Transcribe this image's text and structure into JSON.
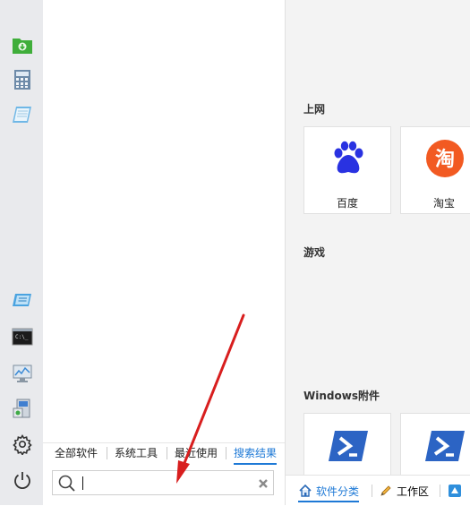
{
  "tabs": [
    {
      "label": "全部软件"
    },
    {
      "label": "系统工具"
    },
    {
      "label": "最近使用"
    },
    {
      "label": "搜索结果",
      "active": true
    }
  ],
  "search": {
    "value": "",
    "placeholder": ""
  },
  "sections": {
    "internet": {
      "title": "上网",
      "apps": [
        {
          "label": "百度",
          "icon": "baidu-paw-icon"
        },
        {
          "label": "淘宝",
          "icon": "taobao-icon"
        }
      ]
    },
    "games": {
      "title": "游戏"
    },
    "accessories": {
      "title": "Windows附件",
      "apps": [
        {
          "label": "",
          "icon": "powershell-icon"
        },
        {
          "label": "",
          "icon": "powershell-icon"
        }
      ]
    }
  },
  "bottom_tabs": [
    {
      "label": "软件分类",
      "icon": "home-icon",
      "active": true
    },
    {
      "label": "工作区",
      "icon": "pencil-icon"
    }
  ],
  "colors": {
    "accent": "#1e79d6",
    "baidu": "#2932e1",
    "taobao": "#f25a22",
    "powershell": "#2c64c4",
    "arrow": "#d81e1e"
  },
  "rail_icons": [
    "downloads-folder-icon",
    "calculator-icon",
    "notepad-icon",
    "remote-desktop-icon",
    "command-prompt-icon",
    "performance-monitor-icon",
    "control-panel-icon",
    "settings-icon",
    "power-icon"
  ]
}
